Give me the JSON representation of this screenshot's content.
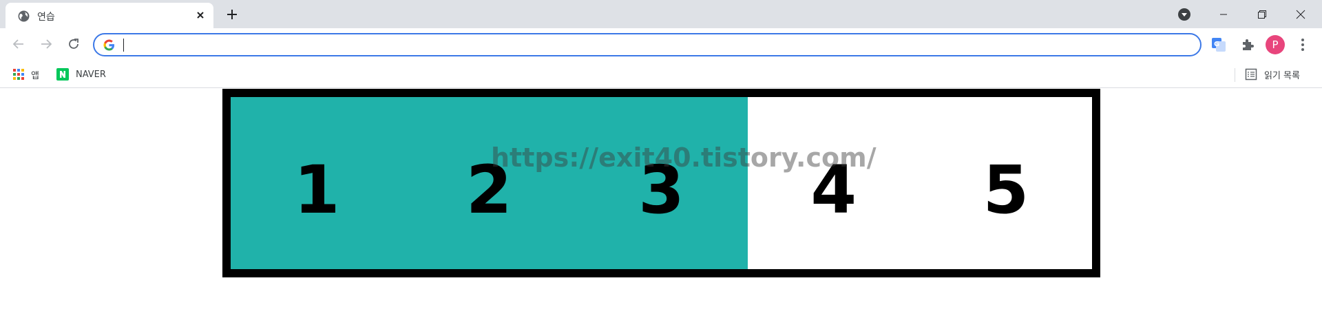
{
  "tab": {
    "title": "연습"
  },
  "toolbar": {
    "address_value": "",
    "avatar_letter": "P"
  },
  "bookmarks": {
    "apps_label": "앱",
    "naver_label": "NAVER",
    "reading_list_label": "읽기 목록"
  },
  "content": {
    "fill_color": "#20b2aa",
    "fill_fraction": 0.6,
    "cells": [
      "1",
      "2",
      "3",
      "4",
      "5"
    ],
    "watermark": "https://exit40.tistory.com/"
  }
}
